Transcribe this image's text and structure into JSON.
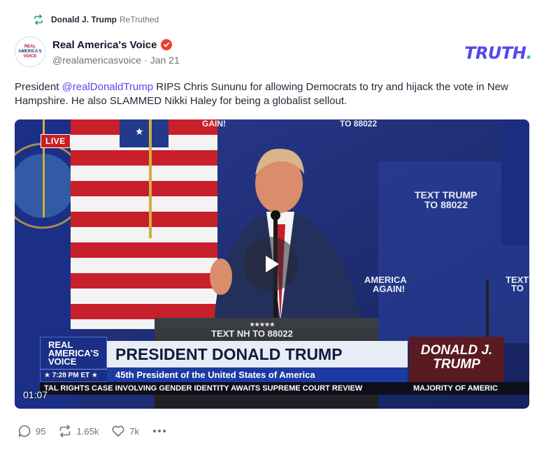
{
  "retruth": {
    "name": "Donald J. Trump",
    "label": "ReTruthed"
  },
  "author": {
    "display_name": "Real America's Voice",
    "handle": "@realamericasvoice",
    "separator": "·",
    "date": "Jan 21",
    "avatar_text": [
      "REAL",
      "AMERICA'S",
      "VOICE"
    ]
  },
  "brand": {
    "name": "TRUTH",
    "dot": "."
  },
  "post": {
    "prefix": "President ",
    "mention": "@realDonaldTrump",
    "suffix": " RIPS Chris Sununu for allowing Democrats to try and hijack the vote in New Hampshire. He also SLAMMED Nikki Haley for being a globalist sellout."
  },
  "video": {
    "live_label": "LIVE",
    "duration": "01:07",
    "backdrop_texts": [
      "GAIN!",
      "TO 88022",
      "TEXT TRUMP",
      "TO 88022",
      "AMERICA",
      "AGAIN!",
      "TEXT",
      "TO",
      "TEXT NH TO 88022",
      "★★★★★"
    ],
    "lower_third": {
      "logo_lines": [
        "REAL",
        "AMERICA'S",
        "VOICE"
      ],
      "time": "★ 7:28 PM ET ★",
      "headline": "PRESIDENT DONALD TRUMP",
      "subline": "45th President of the United States of America",
      "right_lines": [
        "DONALD J.",
        "TRUMP"
      ],
      "ticker_left": "TAL RIGHTS CASE INVOLVING GENDER IDENTITY AWAITS SUPREME COURT REVIEW",
      "ticker_right": "MAJORITY OF AMERIC"
    }
  },
  "actions": {
    "replies": "95",
    "retruths": "1.65k",
    "likes": "7k"
  },
  "colors": {
    "brand": "#5448ee",
    "brand_dot": "#1bc3c1",
    "verified": "#e8412c",
    "muted": "#6b7280",
    "retruth_icon": "#22a06b"
  }
}
